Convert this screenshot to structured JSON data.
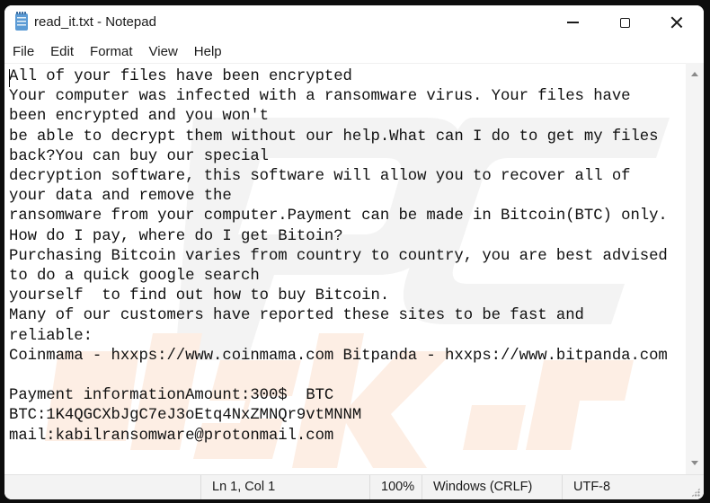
{
  "window": {
    "title": "read_it.txt - Notepad",
    "app_icon": "notepad-icon",
    "controls": {
      "minimize": "minimize-icon",
      "maximize": "maximize-icon",
      "close": "close-icon"
    }
  },
  "menu": {
    "items": [
      {
        "label": "File"
      },
      {
        "label": "Edit"
      },
      {
        "label": "Format"
      },
      {
        "label": "View"
      },
      {
        "label": "Help"
      }
    ]
  },
  "document": {
    "lines": [
      "All of your files have been encrypted",
      "Your computer was infected with a ransomware virus. Your files have",
      "been encrypted and you won't",
      "be able to decrypt them without our help.What can I do to get my files",
      "back?You can buy our special",
      "decryption software, this software will allow you to recover all of",
      "your data and remove the",
      "ransomware from your computer.Payment can be made in Bitcoin(BTC) only.",
      "How do I pay, where do I get Bitoin?",
      "Purchasing Bitcoin varies from country to country, you are best advised",
      "to do a quick google search",
      "yourself  to find out how to buy Bitcoin.",
      "Many of our customers have reported these sites to be fast and",
      "reliable:",
      "Coinmama - hxxps://www.coinmama.com Bitpanda - hxxps://www.bitpanda.com",
      "",
      "Payment informationAmount:300$  BTC",
      "BTC:1K4QGCXbJgC7eJ3oEtq4NxZMNQr9vtMNNM",
      "mail:kabilransomware@protonmail.com"
    ]
  },
  "watermark": {
    "text_top": "PC",
    "text_bottom": "risk.com"
  },
  "statusbar": {
    "position": "Ln 1, Col 1",
    "zoom": "100%",
    "line_ending": "Windows (CRLF)",
    "encoding": "UTF-8"
  },
  "colors": {
    "watermark_gray": "#f3f3f3",
    "watermark_orange": "#fdeee4"
  }
}
